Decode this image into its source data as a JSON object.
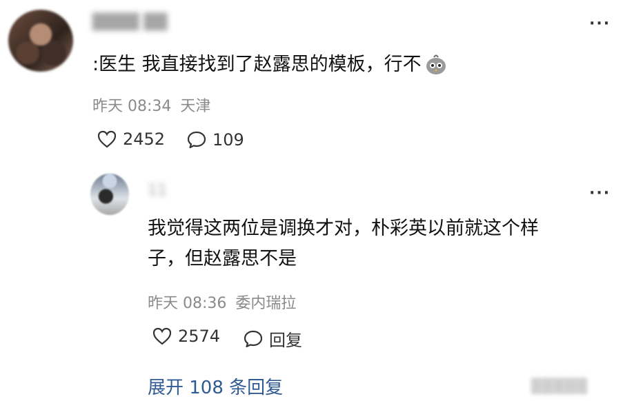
{
  "main_comment": {
    "username": "████ ██",
    "text": ":医生 我直接找到了赵露思的模板，行不",
    "time": "昨天 08:34",
    "location": "天津",
    "likes": "2452",
    "replies": "109",
    "more": "···",
    "emoji_icon": "chick-face-icon"
  },
  "reply": {
    "username": "11",
    "text_line1": "我觉得这两位是调换才对，朴彩英以前就这个样",
    "text_line2": "子，但赵露思不是",
    "time": "昨天 08:36",
    "location": "委内瑞拉",
    "likes": "2574",
    "reply_label": "回复",
    "more": "···"
  },
  "expand_label": "展开 108 条回复",
  "watermark": "█████"
}
